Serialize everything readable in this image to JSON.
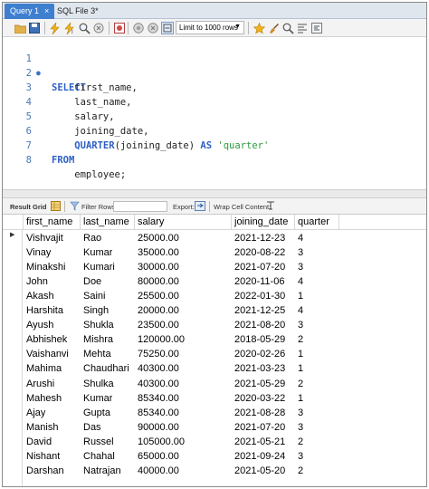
{
  "tabs": [
    {
      "label": "Query 1",
      "close": "×",
      "active": true
    },
    {
      "label": "SQL File 3*",
      "active": false
    }
  ],
  "toolbar": {
    "limit_label": "Limit to 1000 rows",
    "icons": [
      "folder-open-icon",
      "save-icon",
      "lightning-icon",
      "lightning-cursor-icon",
      "magnifier-icon",
      "stop-icon",
      "no-error-icon",
      "commit-icon",
      "rollback-icon",
      "toggle-icon",
      "star-icon",
      "brush-icon",
      "search-icon",
      "format-icon",
      "wrap-icon"
    ]
  },
  "editor": {
    "lines": [
      {
        "n": "1",
        "parts": [
          {
            "t": "SELECT",
            "c": "kw"
          }
        ]
      },
      {
        "n": "2",
        "parts": [
          {
            "t": "    first_name,",
            "c": "plain"
          }
        ]
      },
      {
        "n": "3",
        "parts": [
          {
            "t": "    last_name,",
            "c": "plain"
          }
        ]
      },
      {
        "n": "4",
        "parts": [
          {
            "t": "    salary,",
            "c": "plain"
          }
        ]
      },
      {
        "n": "5",
        "parts": [
          {
            "t": "    joining_date,",
            "c": "plain"
          }
        ]
      },
      {
        "n": "6",
        "parts": [
          {
            "t": "    ",
            "c": "plain"
          },
          {
            "t": "QUARTER",
            "c": "kw"
          },
          {
            "t": "(joining_date) ",
            "c": "plain"
          },
          {
            "t": "AS",
            "c": "kw"
          },
          {
            "t": " ",
            "c": "plain"
          },
          {
            "t": "'quarter'",
            "c": "str"
          }
        ]
      },
      {
        "n": "7",
        "parts": [
          {
            "t": "FROM",
            "c": "kw"
          }
        ]
      },
      {
        "n": "8",
        "parts": [
          {
            "t": "    employee;",
            "c": "plain"
          }
        ]
      }
    ]
  },
  "result_toolbar": {
    "grid_label": "Result Grid",
    "filter_label": "Filter Rows:",
    "export_label": "Export:",
    "wrap_label": "Wrap Cell Content:"
  },
  "grid": {
    "columns": [
      "first_name",
      "last_name",
      "salary",
      "joining_date",
      "quarter"
    ],
    "rows": [
      [
        "Vishvajit",
        "Rao",
        "25000.00",
        "2021-12-23",
        "4"
      ],
      [
        "Vinay",
        "Kumar",
        "35000.00",
        "2020-08-22",
        "3"
      ],
      [
        "Minakshi",
        "Kumari",
        "30000.00",
        "2021-07-20",
        "3"
      ],
      [
        "John",
        "Doe",
        "80000.00",
        "2020-11-06",
        "4"
      ],
      [
        "Akash",
        "Saini",
        "25500.00",
        "2022-01-30",
        "1"
      ],
      [
        "Harshita",
        "Singh",
        "20000.00",
        "2021-12-25",
        "4"
      ],
      [
        "Ayush",
        "Shukla",
        "23500.00",
        "2021-08-20",
        "3"
      ],
      [
        "Abhishek",
        "Mishra",
        "120000.00",
        "2018-05-29",
        "2"
      ],
      [
        "Vaishanvi",
        "Mehta",
        "75250.00",
        "2020-02-26",
        "1"
      ],
      [
        "Mahima",
        "Chaudhari",
        "40300.00",
        "2021-03-23",
        "1"
      ],
      [
        "Arushi",
        "Shulka",
        "40300.00",
        "2021-05-29",
        "2"
      ],
      [
        "Mahesh",
        "Kumar",
        "85340.00",
        "2020-03-22",
        "1"
      ],
      [
        "Ajay",
        "Gupta",
        "85340.00",
        "2021-08-28",
        "3"
      ],
      [
        "Manish",
        "Das",
        "90000.00",
        "2021-07-20",
        "3"
      ],
      [
        "David",
        "Russel",
        "105000.00",
        "2021-05-21",
        "2"
      ],
      [
        "Nishant",
        "Chahal",
        "65000.00",
        "2021-09-24",
        "3"
      ],
      [
        "Darshan",
        "Natrajan",
        "40000.00",
        "2021-05-20",
        "2"
      ]
    ],
    "current_row_marker": "▶"
  }
}
